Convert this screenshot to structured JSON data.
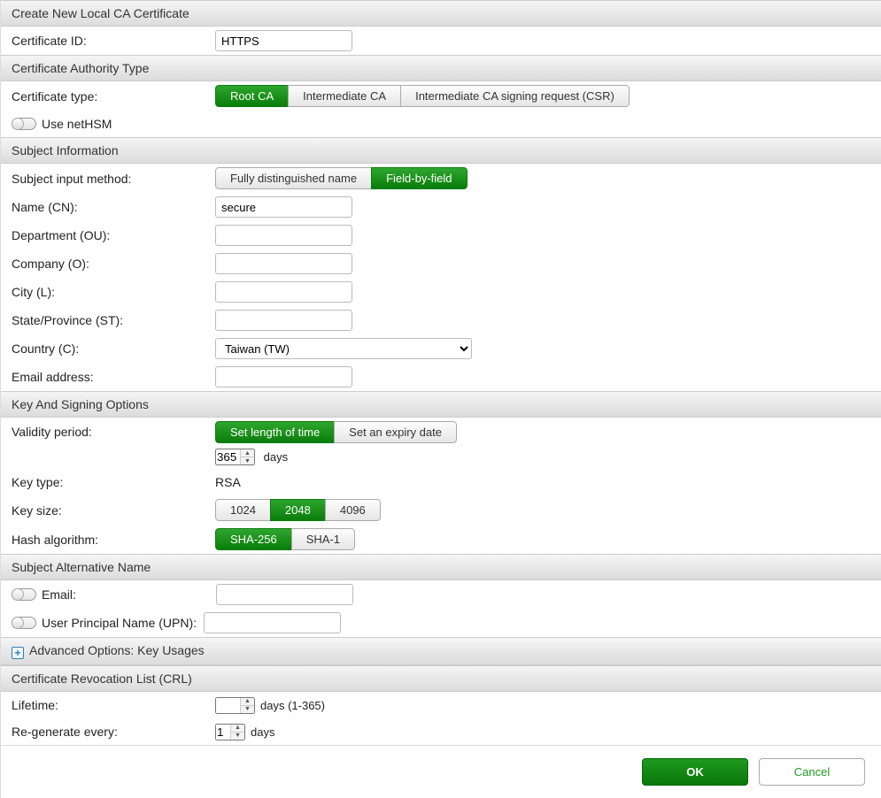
{
  "sections": {
    "create": "Create New Local CA Certificate",
    "catype": "Certificate Authority Type",
    "subject": "Subject Information",
    "keysign": "Key And Signing Options",
    "san": "Subject Alternative Name",
    "adv": "Advanced Options: Key Usages",
    "crl": "Certificate Revocation List (CRL)"
  },
  "certid": {
    "label": "Certificate ID:",
    "value": "HTTPS"
  },
  "certtype": {
    "label": "Certificate type:",
    "options": [
      "Root CA",
      "Intermediate CA",
      "Intermediate CA signing request (CSR)"
    ],
    "selected": 0
  },
  "nethsm": {
    "label": "Use netHSM",
    "on": false
  },
  "inputmethod": {
    "label": "Subject input method:",
    "options": [
      "Fully distinguished name",
      "Field-by-field"
    ],
    "selected": 1
  },
  "cn": {
    "label": "Name (CN):",
    "value": "secure"
  },
  "ou": {
    "label": "Department (OU):",
    "value": ""
  },
  "o": {
    "label": "Company (O):",
    "value": ""
  },
  "l": {
    "label": "City (L):",
    "value": ""
  },
  "st": {
    "label": "State/Province (ST):",
    "value": ""
  },
  "c": {
    "label": "Country (C):",
    "value": "Taiwan (TW)"
  },
  "email": {
    "label": "Email address:",
    "value": ""
  },
  "validity": {
    "label": "Validity period:",
    "options": [
      "Set length of time",
      "Set an expiry date"
    ],
    "selected": 0,
    "days": "365",
    "unit": "days"
  },
  "keytype": {
    "label": "Key type:",
    "value": "RSA"
  },
  "keysize": {
    "label": "Key size:",
    "options": [
      "1024",
      "2048",
      "4096"
    ],
    "selected": 1
  },
  "hash": {
    "label": "Hash algorithm:",
    "options": [
      "SHA-256",
      "SHA-1"
    ],
    "selected": 0
  },
  "san_email": {
    "label": "Email:",
    "on": false,
    "value": ""
  },
  "san_upn": {
    "label": "User Principal Name (UPN):",
    "on": false,
    "value": ""
  },
  "lifetime": {
    "label": "Lifetime:",
    "value": "",
    "unit": "days (1-365)"
  },
  "regen": {
    "label": "Re-generate every:",
    "value": "1",
    "unit": "days"
  },
  "buttons": {
    "ok": "OK",
    "cancel": "Cancel"
  }
}
